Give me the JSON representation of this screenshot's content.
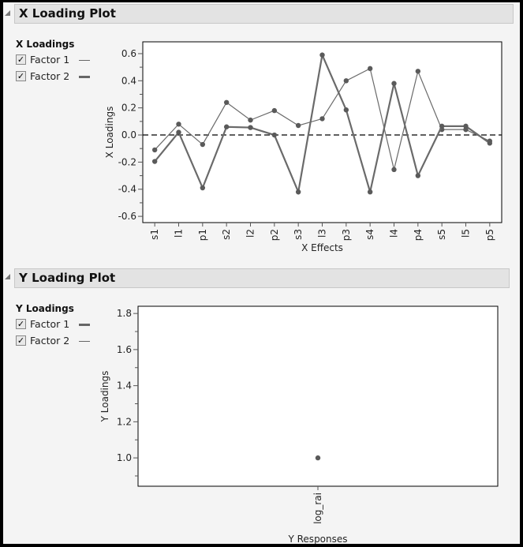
{
  "sections": [
    {
      "title": "X Loading Plot",
      "legend": {
        "title": "X Loadings",
        "items": [
          {
            "label": "Factor 1",
            "checked": true,
            "check_glyph": "✓"
          },
          {
            "label": "Factor 2",
            "checked": true,
            "check_glyph": "✓"
          }
        ]
      }
    },
    {
      "title": "Y Loading Plot",
      "legend": {
        "title": "Y Loadings",
        "items": [
          {
            "label": "Factor 1",
            "checked": true,
            "check_glyph": "✓"
          },
          {
            "label": "Factor 2",
            "checked": true,
            "check_glyph": "✓"
          }
        ]
      }
    }
  ],
  "chart_data": [
    {
      "type": "line",
      "title": "X Loading Plot",
      "xlabel": "X Effects",
      "ylabel": "X Loadings",
      "categories": [
        "s1",
        "l1",
        "p1",
        "s2",
        "l2",
        "p2",
        "s3",
        "l3",
        "p3",
        "s4",
        "l4",
        "p4",
        "s5",
        "l5",
        "p5"
      ],
      "series": [
        {
          "name": "Factor 1",
          "values": [
            -0.11,
            0.08,
            -0.07,
            0.24,
            0.11,
            0.18,
            0.07,
            0.12,
            0.4,
            0.49,
            -0.255,
            0.47,
            0.04,
            0.04,
            -0.045
          ]
        },
        {
          "name": "Factor 2",
          "values": [
            -0.195,
            0.02,
            -0.39,
            0.06,
            0.055,
            0.0,
            -0.42,
            0.59,
            0.185,
            -0.42,
            0.38,
            -0.3,
            0.065,
            0.065,
            -0.06
          ]
        }
      ],
      "ylim": [
        -0.646,
        0.687
      ],
      "yticks": [
        "0.6",
        "0.4",
        "0.2",
        "0.0",
        "-0.2",
        "-0.4",
        "-0.6"
      ],
      "reference_line": {
        "y": 0.0,
        "style": "dashed"
      },
      "grid": false,
      "legend": "left"
    },
    {
      "type": "scatter",
      "title": "Y Loading Plot",
      "xlabel": "Y Responses",
      "ylabel": "Y Loadings",
      "categories": [
        "log_rai"
      ],
      "series": [
        {
          "name": "Factor 1",
          "values": [
            1.0
          ]
        }
      ],
      "ylim": [
        0.843,
        1.84
      ],
      "yticks": [
        "1.8",
        "1.6",
        "1.4",
        "1.2",
        "1.0"
      ],
      "grid": false,
      "legend": "left"
    }
  ]
}
